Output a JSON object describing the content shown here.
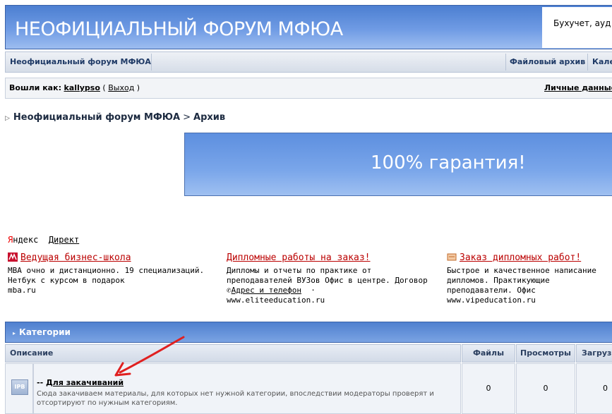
{
  "header": {
    "title": "НЕОФИЦИАЛЬНЫЙ ФОРУМ МФЮА",
    "ad_text": "Бухучет, ауд"
  },
  "nav": {
    "left": "Неофициальный форум МФЮА",
    "file_archive": "Файловый архив",
    "calendar": "Кале"
  },
  "userbar": {
    "logged_as": "Вошли как:",
    "username": "kallypso",
    "logout": "Выход",
    "personal": "Личные данные"
  },
  "breadcrumb": {
    "root": "Неофициальный форум МФЮА",
    "separator": ">",
    "current": "Архив"
  },
  "banner_ad": {
    "text": "100% гарантия!"
  },
  "yandex": {
    "ya": "Я",
    "ndex": "ндекс",
    "direct": "Директ"
  },
  "ads": [
    {
      "title": "Ведущая бизнес-школа",
      "body": "MBA очно и дистанционно. 19 специализаций. Нетбук с курсом в подарок",
      "domain": "mba.ru"
    },
    {
      "title": "Дипломные работы на заказ!",
      "body": "Дипломы и отчеты по практике от преподавателей ВУЗов Офис в центре. Договор",
      "sub_link": "Адрес и телефон",
      "sub_dot": "·",
      "domain": "www.eliteeducation.ru"
    },
    {
      "title": "Заказ дипломных работ!",
      "body": "Быстрое и качественное написание дипломов. Практикующие преподаватели. Офис",
      "domain": "www.vipeducation.ru"
    }
  ],
  "categories": {
    "header": "Категории",
    "columns": {
      "description": "Описание",
      "files": "Файлы",
      "views": "Просмотры",
      "downloads": "Загрузки"
    },
    "rows": [
      {
        "icon_label": "IPB",
        "prefix": "-- ",
        "title": "Для закачиваний",
        "description": "Сюда закачиваем материалы, для которых нет нужной категории, впоследствии модераторы проверят и отсортируют по нужным категориям.",
        "files": "0",
        "views": "0",
        "downloads": "0"
      }
    ]
  },
  "colors": {
    "banner_blue": "#4c7fd1",
    "ad_title_red": "#b00000",
    "annotation_arrow": "#e02020"
  }
}
